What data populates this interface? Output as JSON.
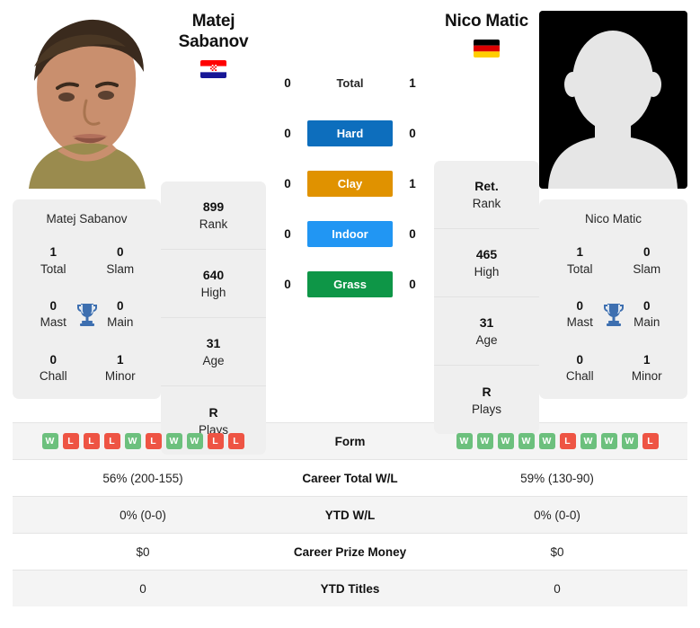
{
  "left_player": {
    "name_line1": "Matej",
    "name_line2": "Sabanov",
    "full_name": "Matej Sabanov",
    "flag": "croatia-flag",
    "photo": "player-photo",
    "rank": "899",
    "rank_label": "Rank",
    "high": "640",
    "high_label": "High",
    "age": "31",
    "age_label": "Age",
    "plays": "R",
    "plays_label": "Plays",
    "titles": {
      "total": "1",
      "total_label": "Total",
      "slam": "0",
      "slam_label": "Slam",
      "mast": "0",
      "mast_label": "Mast",
      "main": "0",
      "main_label": "Main",
      "chall": "0",
      "chall_label": "Chall",
      "minor": "1",
      "minor_label": "Minor"
    },
    "form": [
      "W",
      "L",
      "L",
      "L",
      "W",
      "L",
      "W",
      "W",
      "L",
      "L"
    ],
    "career_total_wl": "56% (200-155)",
    "ytd_wl": "0% (0-0)",
    "career_prize_money": "$0",
    "ytd_titles": "0"
  },
  "right_player": {
    "name_line1": "Nico Matic",
    "name_line2": "",
    "full_name": "Nico Matic",
    "flag": "germany-flag",
    "photo": "player-photo-placeholder",
    "rank": "Ret.",
    "rank_label": "Rank",
    "high": "465",
    "high_label": "High",
    "age": "31",
    "age_label": "Age",
    "plays": "R",
    "plays_label": "Plays",
    "titles": {
      "total": "1",
      "total_label": "Total",
      "slam": "0",
      "slam_label": "Slam",
      "mast": "0",
      "mast_label": "Mast",
      "main": "0",
      "main_label": "Main",
      "chall": "0",
      "chall_label": "Chall",
      "minor": "1",
      "minor_label": "Minor"
    },
    "form": [
      "W",
      "W",
      "W",
      "W",
      "W",
      "L",
      "W",
      "W",
      "W",
      "L"
    ],
    "career_total_wl": "59% (130-90)",
    "ytd_wl": "0% (0-0)",
    "career_prize_money": "$0",
    "ytd_titles": "0"
  },
  "head_to_head": [
    {
      "label": "Total",
      "left": "0",
      "right": "1",
      "color": "",
      "text_color": "#272727"
    },
    {
      "label": "Hard",
      "left": "0",
      "right": "0",
      "color": "#0d6ebd",
      "text_color": "#ffffff"
    },
    {
      "label": "Clay",
      "left": "0",
      "right": "1",
      "color": "#e09200",
      "text_color": "#ffffff"
    },
    {
      "label": "Indoor",
      "left": "0",
      "right": "0",
      "color": "#2196f3",
      "text_color": "#ffffff"
    },
    {
      "label": "Grass",
      "left": "0",
      "right": "0",
      "color": "#0e9647",
      "text_color": "#ffffff"
    }
  ],
  "stats_rows": [
    {
      "label": "Form",
      "key": "form",
      "type": "badges"
    },
    {
      "label": "Career Total W/L",
      "key": "career_total_wl",
      "type": "text"
    },
    {
      "label": "YTD W/L",
      "key": "ytd_wl",
      "type": "text"
    },
    {
      "label": "Career Prize Money",
      "key": "career_prize_money",
      "type": "text"
    },
    {
      "label": "YTD Titles",
      "key": "ytd_titles",
      "type": "text"
    }
  ],
  "colors": {
    "card_bg": "#efefef",
    "row_alt_bg": "#f4f4f4",
    "win_badge": "#6cc07d",
    "loss_badge": "#ee5444",
    "trophy": "#3d6fb0"
  }
}
